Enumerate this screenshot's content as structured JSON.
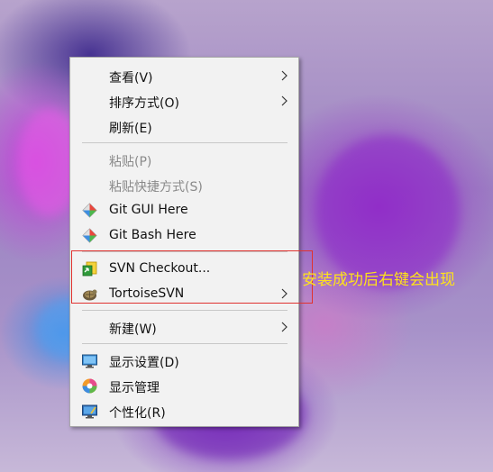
{
  "menu": {
    "items": [
      {
        "label": "查看(V)",
        "has_submenu": true
      },
      {
        "label": "排序方式(O)",
        "has_submenu": true
      },
      {
        "label": "刷新(E)",
        "has_submenu": false
      },
      {
        "label": "粘贴(P)",
        "disabled": true
      },
      {
        "label": "粘贴快捷方式(S)",
        "disabled": true
      },
      {
        "label": "Git GUI Here",
        "icon": "git-icon"
      },
      {
        "label": "Git Bash Here",
        "icon": "git-icon"
      },
      {
        "label": "SVN Checkout...",
        "icon": "svn-checkout-icon"
      },
      {
        "label": "TortoiseSVN",
        "icon": "tortoise-svn-icon",
        "has_submenu": true
      },
      {
        "label": "新建(W)",
        "has_submenu": true
      },
      {
        "label": "显示设置(D)",
        "icon": "display-settings-icon"
      },
      {
        "label": "显示管理",
        "icon": "display-manager-icon"
      },
      {
        "label": "个性化(R)",
        "icon": "personalize-icon"
      }
    ]
  },
  "annotation": {
    "text": "安装成功后右键会出现",
    "color": "#ffe21a",
    "box_color": "#e0322f"
  }
}
